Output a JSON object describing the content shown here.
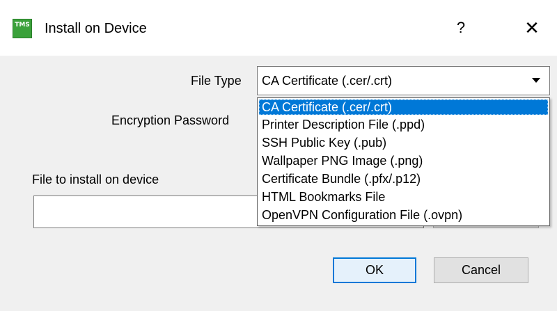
{
  "window": {
    "title": "Install on Device",
    "icon_text": "TMS",
    "icon_subtext": "",
    "help_glyph": "?",
    "close_glyph": "✕"
  },
  "form": {
    "file_type_label": "File Type",
    "file_type_value": "CA Certificate (.cer/.crt)",
    "encryption_password_label": "Encryption Password",
    "file_to_install_label": "File to install on device",
    "file_to_install_value": ""
  },
  "dropdown": {
    "selected_index": 0,
    "options": [
      "CA Certificate (.cer/.crt)",
      "Printer Description File (.ppd)",
      "SSH Public Key (.pub)",
      "Wallpaper PNG Image (.png)",
      "Certificate Bundle (.pfx/.p12)",
      "HTML Bookmarks File",
      "OpenVPN Configuration File (.ovpn)"
    ]
  },
  "buttons": {
    "ok_label": "OK",
    "cancel_label": "Cancel"
  },
  "colors": {
    "selection": "#0078d7",
    "dialog_bg": "#f0f0f0",
    "icon_green": "#3aa13a"
  }
}
